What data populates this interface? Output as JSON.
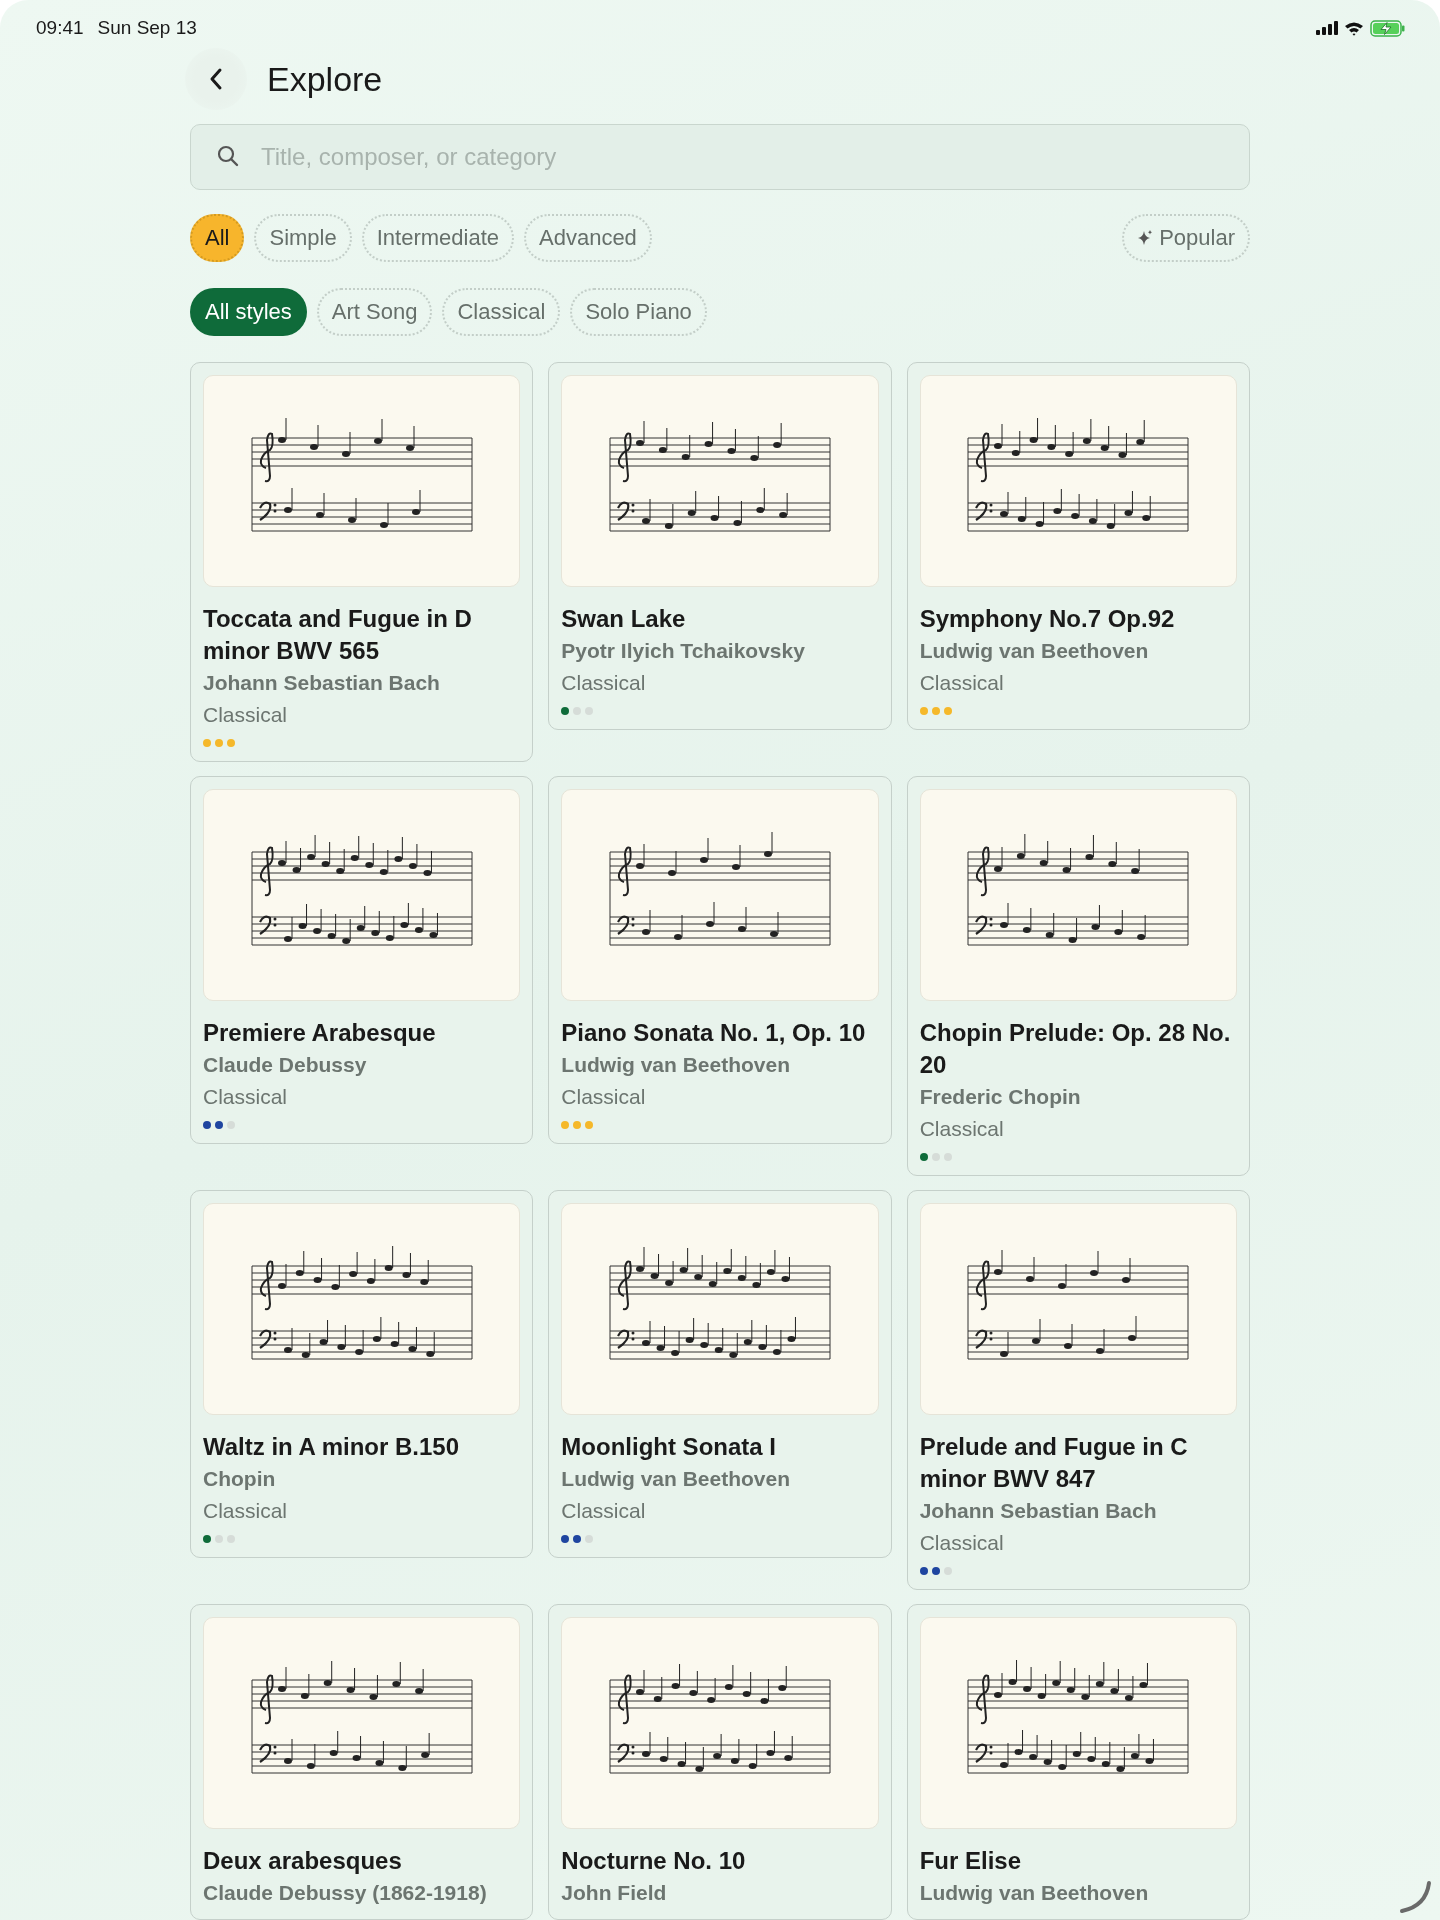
{
  "status_bar": {
    "time": "09:41",
    "date": "Sun Sep 13"
  },
  "header": {
    "title": "Explore"
  },
  "search": {
    "placeholder": "Title, composer, or category"
  },
  "difficulty_filters": [
    {
      "label": "All",
      "selected": true
    },
    {
      "label": "Simple",
      "selected": false
    },
    {
      "label": "Intermediate",
      "selected": false
    },
    {
      "label": "Advanced",
      "selected": false
    }
  ],
  "sort_button": {
    "label": "Popular"
  },
  "style_filters": [
    {
      "label": "All styles",
      "selected": true
    },
    {
      "label": "Art Song",
      "selected": false
    },
    {
      "label": "Classical",
      "selected": false
    },
    {
      "label": "Solo Piano",
      "selected": false
    }
  ],
  "pieces": [
    {
      "title": "Toccata and Fugue in D minor BWV 565",
      "composer": "Johann Sebastian Bach",
      "category": "Classical",
      "stars": 3,
      "color": "#f5b82a"
    },
    {
      "title": "Swan Lake",
      "composer": "Pyotr Ilyich Tchaikovsky",
      "category": "Classical",
      "stars": 1,
      "color": "#0f6b3a"
    },
    {
      "title": "Symphony No.7 Op.92",
      "composer": "Ludwig van Beethoven",
      "category": "Classical",
      "stars": 3,
      "color": "#f5b82a"
    },
    {
      "title": "Premiere Arabesque",
      "composer": "Claude Debussy",
      "category": "Classical",
      "stars": 2,
      "color": "#1f45a0"
    },
    {
      "title": "Piano Sonata No. 1, Op. 10",
      "composer": "Ludwig van Beethoven",
      "category": "Classical",
      "stars": 3,
      "color": "#f5b82a"
    },
    {
      "title": "Chopin Prelude: Op. 28 No. 20",
      "composer": "Frederic Chopin",
      "category": "Classical",
      "stars": 1,
      "color": "#0f6b3a"
    },
    {
      "title": "Waltz in A minor B.150",
      "composer": "Chopin",
      "category": "Classical",
      "stars": 1,
      "color": "#0f6b3a"
    },
    {
      "title": "Moonlight Sonata I",
      "composer": "Ludwig van Beethoven",
      "category": "Classical",
      "stars": 2,
      "color": "#1f45a0"
    },
    {
      "title": "Prelude and Fugue in C minor BWV 847",
      "composer": "Johann Sebastian Bach",
      "category": "Classical",
      "stars": 2,
      "color": "#1f45a0"
    },
    {
      "title": "Deux arabesques",
      "composer": "Claude Debussy (1862-1918)"
    },
    {
      "title": "Nocturne No. 10",
      "composer": "John Field"
    },
    {
      "title": "Fur Elise",
      "composer": "Ludwig van Beethoven"
    }
  ]
}
